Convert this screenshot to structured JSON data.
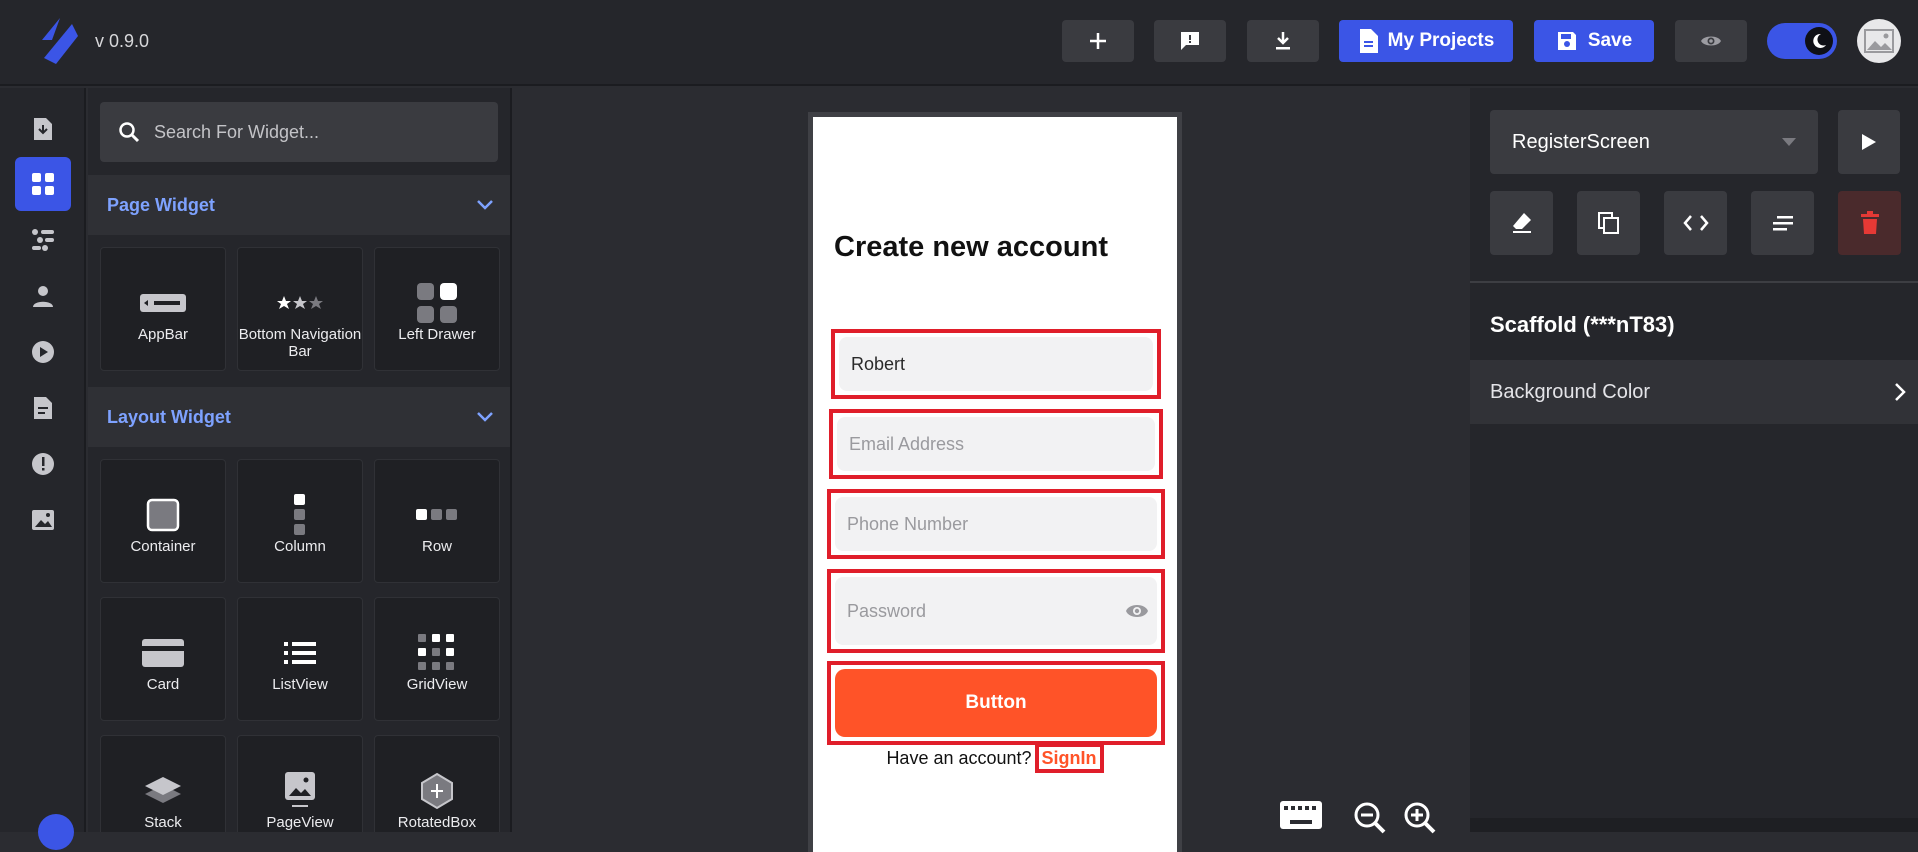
{
  "header": {
    "version": "v 0.9.0",
    "my_projects_label": "My Projects",
    "save_label": "Save"
  },
  "widget_panel": {
    "search_placeholder": "Search For Widget...",
    "page_section": {
      "title": "Page Widget",
      "items": [
        "AppBar",
        "Bottom Navigation Bar",
        "Left Drawer"
      ]
    },
    "layout_section": {
      "title": "Layout Widget",
      "items": [
        "Container",
        "Column",
        "Row",
        "Card",
        "ListView",
        "GridView",
        "Stack",
        "PageView",
        "RotatedBox"
      ]
    }
  },
  "phone": {
    "title": "Create new account",
    "name_value": "Robert",
    "email_placeholder": "Email Address",
    "phone_placeholder": "Phone Number",
    "password_placeholder": "Password",
    "button_label": "Button",
    "have_account_text": "Have an account?",
    "signin_label": "SignIn"
  },
  "properties": {
    "screen_name": "RegisterScreen",
    "widget_name": "Scaffold (***nT83)",
    "background_color_label": "Background Color"
  },
  "colors": {
    "accent": "#3b55e6",
    "orange": "#ff5328",
    "highlight": "#e01e2a"
  }
}
